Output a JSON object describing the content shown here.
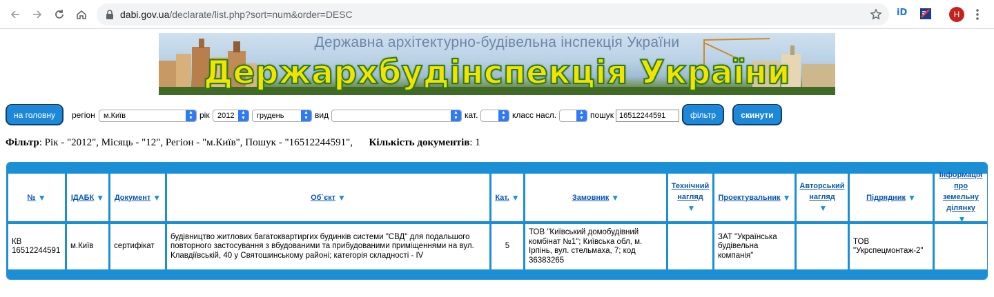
{
  "browser": {
    "url_host": "dabi.gov.ua",
    "url_path": "/declarate/list.php?sort=num&order=DESC",
    "avatar_letter": "H"
  },
  "banner": {
    "top_text": "Державна архітектурно-будівельна інспекція України",
    "main_text": "Держархбудінспекція України"
  },
  "filter": {
    "home_button": "на головну",
    "region_label": "регіон",
    "region_value": "м.Київ",
    "year_label": "рік",
    "year_value": "2012",
    "month_value": "грудень",
    "type_label": "вид",
    "type_value": "",
    "cat_label": "кат.",
    "cat_value": "",
    "class_label": "класс насл.",
    "class_value": "",
    "search_label": "пошук",
    "search_value": "16512244591",
    "filter_button": "фільтр",
    "reset_button": "скинути"
  },
  "summary": {
    "filter_label": "Фільтр",
    "filter_text": ": Рік - \"2012\", Місяць - \"12\", Регіон - \"м.Київ\", Пошук - \"16512244591\",",
    "count_label": "Кількість документів",
    "count_value": ": 1"
  },
  "table": {
    "headers": [
      {
        "key": "num",
        "label": "№"
      },
      {
        "key": "idabk",
        "label": "ІДАБК"
      },
      {
        "key": "doc",
        "label": "Документ"
      },
      {
        "key": "object",
        "label": "Об`єкт"
      },
      {
        "key": "cat",
        "label": "Кат."
      },
      {
        "key": "customer",
        "label": "Замовник"
      },
      {
        "key": "tech",
        "label": "Технічний нагляд"
      },
      {
        "key": "designer",
        "label": "Проектувальник"
      },
      {
        "key": "author",
        "label": "Авторський нагляд"
      },
      {
        "key": "contractor",
        "label": "Підрядник"
      },
      {
        "key": "land",
        "label": "Інформація про земельну ділянку"
      }
    ],
    "rows": [
      {
        "num": "КВ 16512244591",
        "idabk": "м.Київ",
        "doc": "сертифікат",
        "object": "будівництво житлових багатоквартиргих будинків системи \"СВД\" для подальшого повторного застосування з вбудованими та прибудованими приміщеннями на вул. Клавдіївській, 40 у Святошинському районі; категорія складності - IV",
        "cat": "5",
        "customer": "ТОВ \"Київський домобудівний комбінат №1\"; Київська обл, м. Ірпінь, вул. стельмаха, 7; код 36383265",
        "tech": "",
        "designer": "ЗАТ \"Українська будівельна компанія\"",
        "author": "",
        "contractor": "ТОВ \"Укрспецмонтаж-2\"",
        "land": ""
      }
    ]
  }
}
